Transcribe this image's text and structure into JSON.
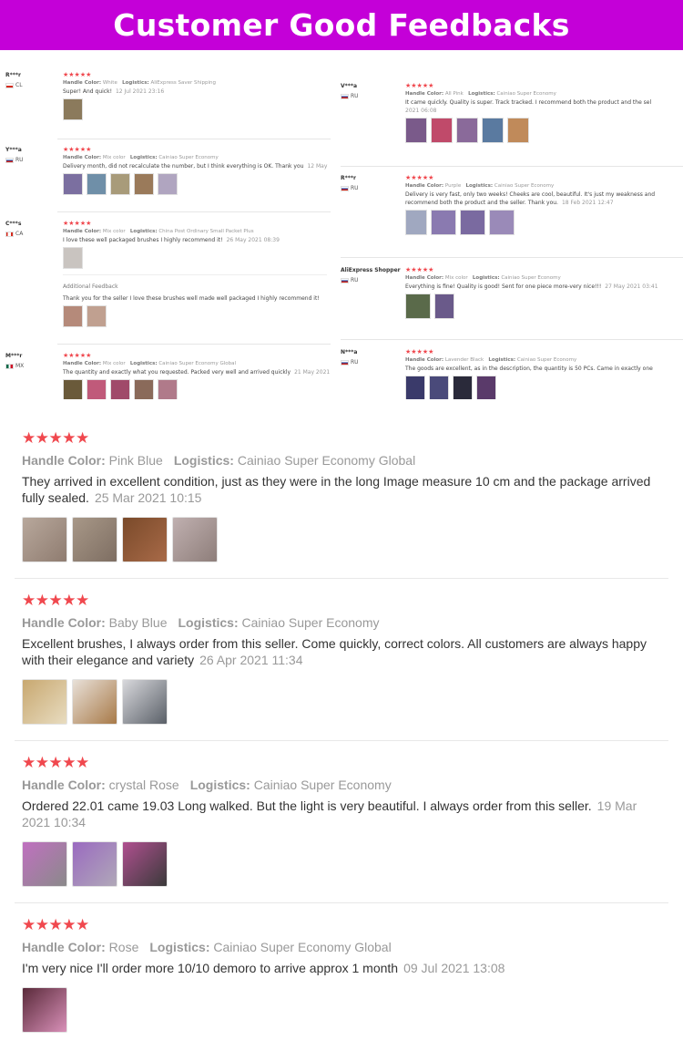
{
  "banner": {
    "title": "Customer Good Feedbacks"
  },
  "collage": {
    "left": [
      {
        "user": "R***r",
        "country": "CL",
        "stars": "★★★★★",
        "color_label": "Handle Color:",
        "color": "White",
        "log_label": "Logistics:",
        "logistics": "AliExpress Saver Shipping",
        "text": "Super! And quick!",
        "date": "12 Jul 2021 23:16",
        "thumbs": [
          "#8b7a5c"
        ]
      },
      {
        "user": "Y***a",
        "country": "RU",
        "stars": "★★★★★",
        "color_label": "Handle Color:",
        "color": "Mix color",
        "log_label": "Logistics:",
        "logistics": "Cainiao Super Economy",
        "text": "Delivery month, did not recalculate the number, but I think everything is OK. Thank you",
        "date": "12 May",
        "thumbs": [
          "#7b6fa0",
          "#6f8fa8",
          "#a89b7a",
          "#9a7a5a",
          "#b0a5c0"
        ]
      },
      {
        "user": "C***s",
        "country": "CA",
        "stars": "★★★★★",
        "color_label": "Handle Color:",
        "color": "Mix color",
        "log_label": "Logistics:",
        "logistics": "China Post Ordinary Small Packet Plus",
        "text": "I love these well packaged brushes I highly recommend it!",
        "date": "26 May 2021 08:39",
        "thumbs": [
          "#c9c4c0"
        ],
        "additional_label": "Additional Feedback",
        "additional_text": "Thank you for the seller I love these brushes well made well packaged I highly recommend it!",
        "add_thumbs": [
          "#b58a7a",
          "#c0a090"
        ]
      },
      {
        "user": "M***r",
        "country": "MX",
        "stars": "★★★★★",
        "color_label": "Handle Color:",
        "color": "Mix color",
        "log_label": "Logistics:",
        "logistics": "Cainiao Super Economy Global",
        "text": "The quantity and exactly what you requested. Packed very well and arrived quickly",
        "date": "21 May 2021",
        "thumbs": [
          "#6a5a3a",
          "#c05a7a",
          "#a04a6a",
          "#8a6a5a",
          "#b07a8a"
        ]
      }
    ],
    "right": [
      {
        "user": "V***a",
        "country": "RU",
        "stars": "★★★★★",
        "color_label": "Handle Color:",
        "color": "All Pink",
        "log_label": "Logistics:",
        "logistics": "Cainiao Super Economy",
        "text": "It came quickly. Quality is super. Track tracked. I recommend both the product and the sel",
        "date": "2021 06:08",
        "thumbs": [
          "#7a5a8a",
          "#c04a6a",
          "#8a6a9a",
          "#5a7aa0",
          "#c08a5a"
        ]
      },
      {
        "user": "R***r",
        "country": "RU",
        "stars": "★★★★★",
        "color_label": "Handle Color:",
        "color": "Purple",
        "log_label": "Logistics:",
        "logistics": "Cainiao Super Economy",
        "text": "Delivery is very fast, only two weeks! Cheeks are cool, beautiful. It's just my weakness and",
        "text2": "recommend both the product and the seller. Thank you.",
        "date": "18 Feb 2021 12:47",
        "thumbs": [
          "#a0a8c0",
          "#8a7ab0",
          "#7a6aa0",
          "#9a8ab8"
        ]
      },
      {
        "user": "AliExpress Shopper",
        "country": "RU",
        "stars": "★★★★★",
        "color_label": "Handle Color:",
        "color": "Mix color",
        "log_label": "Logistics:",
        "logistics": "Cainiao Super Economy",
        "text": "Everything is fine! Quality is good! Sent for one piece more-very nice!!!",
        "date": "27 May 2021 03:41",
        "thumbs": [
          "#5a6a4a",
          "#6a5a8a"
        ]
      },
      {
        "user": "N***a",
        "country": "RU",
        "stars": "★★★★★",
        "color_label": "Handle Color:",
        "color": "Lavender Black",
        "log_label": "Logistics:",
        "logistics": "Cainiao Super Economy",
        "text": "The goods are excellent, as in the description, the quantity is 50 PCs. Came in exactly one",
        "date": "",
        "thumbs": [
          "#3a3a6a",
          "#4a4a7a",
          "#2a2a3a",
          "#5a3a6a"
        ]
      }
    ]
  },
  "reviews": [
    {
      "stars": "★★★★★",
      "color_label": "Handle Color:",
      "color": "Pink Blue",
      "log_label": "Logistics:",
      "logistics": "Cainiao Super Economy Global",
      "text": "They arrived in excellent condition, just as they were in the long Image measure 10 cm and the package arrived fully sealed.",
      "date": "25 Mar 2021 10:15",
      "thumbs": [
        "#a8968a",
        "#9a8a7e",
        "#8a5a3a",
        "#b0a0a0"
      ]
    },
    {
      "stars": "★★★★★",
      "color_label": "Handle Color:",
      "color": "Baby Blue",
      "log_label": "Logistics:",
      "logistics": "Cainiao Super Economy",
      "text": "Excellent brushes, I always order from this seller. Come quickly, correct colors. All customers are always happy with their elegance and variety",
      "date": "26 Apr 2021 11:34",
      "thumbs": [
        "#c8b48a",
        "#b08a5a",
        "#7a8088"
      ]
    },
    {
      "stars": "★★★★★",
      "color_label": "Handle Color:",
      "color": "crystal Rose",
      "log_label": "Logistics:",
      "logistics": "Cainiao Super Economy",
      "text": "Ordered 22.01 came 19.03 Long walked. But the light is very beautiful. I always order from this seller.",
      "date": "19 Mar 2021 10:34",
      "thumbs": [
        "#9a5a9a",
        "#8a5aa0",
        "#7a4a6a"
      ]
    },
    {
      "stars": "★★★★★",
      "color_label": "Handle Color:",
      "color": "Rose",
      "log_label": "Logistics:",
      "logistics": "Cainiao Super Economy Global",
      "text": "I'm very nice I'll order more 10/10 demoro to arrive approx 1 month",
      "date": "09 Jul 2021 13:08",
      "thumbs": [
        "#8a3a5a"
      ]
    }
  ],
  "colors": {
    "banner": "#c400d8",
    "star": "#f0484e"
  }
}
